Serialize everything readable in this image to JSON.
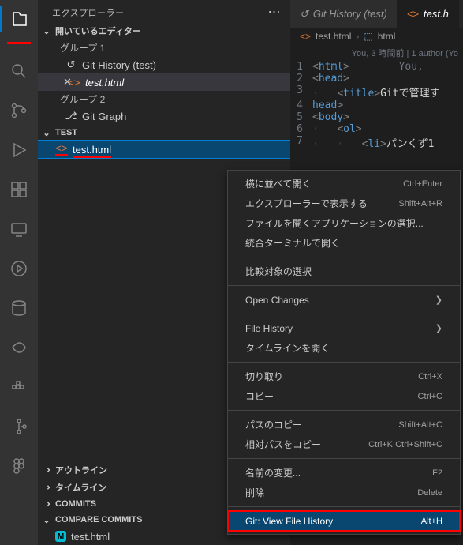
{
  "activity": {
    "items": [
      {
        "name": "files-icon",
        "active": true
      },
      {
        "name": "search-icon"
      },
      {
        "name": "source-control-icon"
      },
      {
        "name": "run-icon"
      },
      {
        "name": "extensions-icon"
      },
      {
        "name": "remote-icon"
      },
      {
        "name": "timeline-icon"
      },
      {
        "name": "database-icon"
      },
      {
        "name": "share-icon"
      },
      {
        "name": "docker-icon"
      },
      {
        "name": "git-icon"
      },
      {
        "name": "figma-icon"
      }
    ]
  },
  "sidebar": {
    "title": "エクスプローラー",
    "openEditors": {
      "label": "開いているエディター",
      "group1": "グループ 1",
      "group2": "グループ 2",
      "items1": [
        {
          "label": "Git History (test)",
          "icon": "history"
        },
        {
          "label": "test.html",
          "icon": "html",
          "active": true
        }
      ],
      "items2": [
        {
          "label": "Git Graph",
          "icon": "graph"
        }
      ]
    },
    "project": {
      "label": "TEST",
      "files": [
        {
          "label": "test.html",
          "icon": "html",
          "selected": true
        }
      ]
    },
    "outline": {
      "label": "アウトライン"
    },
    "timeline": {
      "label": "タイムライン"
    },
    "commits": {
      "label": "COMMITS"
    },
    "compare": {
      "label": "COMPARE COMMITS",
      "items": [
        {
          "badge": "M",
          "label": "test.html"
        }
      ]
    }
  },
  "editor": {
    "tabs": [
      {
        "label": "Git History (test)",
        "icon": "history"
      },
      {
        "label": "test.h",
        "icon": "html",
        "active": true
      }
    ],
    "breadcrumb": [
      {
        "icon": "html",
        "label": "test.html",
        "color": "orange"
      },
      {
        "icon": "brackets",
        "label": "html",
        "color": "blue"
      }
    ],
    "meta": "You, 3 時間前 | 1 author (Yo",
    "lines": [
      {
        "n": "1",
        "indent": 0,
        "open": "<",
        "tag": "html",
        "close": ">",
        "after": "        You,"
      },
      {
        "n": "2",
        "indent": 0,
        "open": "<",
        "tag": "head",
        "close": ">"
      },
      {
        "n": "3",
        "indent": 1,
        "open": "<",
        "tag": "title",
        "close": ">",
        "text": "Gitで管理す"
      },
      {
        "n": "4",
        "indent": 0,
        "open": "</",
        "tag": "head",
        "close": ">"
      },
      {
        "n": "5",
        "indent": 0,
        "open": "<",
        "tag": "body",
        "close": ">"
      },
      {
        "n": "6",
        "indent": 1,
        "open": "<",
        "tag": "ol",
        "close": ">"
      },
      {
        "n": "7",
        "indent": 2,
        "open": "<",
        "tag": "li",
        "close": ">",
        "text": "パンくず1</"
      }
    ]
  },
  "contextMenu": {
    "groups": [
      [
        {
          "label": "横に並べて開く",
          "kbd": "Ctrl+Enter"
        },
        {
          "label": "エクスプローラーで表示する",
          "kbd": "Shift+Alt+R"
        },
        {
          "label": "ファイルを開くアプリケーションの選択..."
        },
        {
          "label": "統合ターミナルで開く"
        }
      ],
      [
        {
          "label": "比較対象の選択"
        }
      ],
      [
        {
          "label": "Open Changes",
          "submenu": true
        }
      ],
      [
        {
          "label": "File History",
          "submenu": true
        },
        {
          "label": "タイムラインを開く"
        }
      ],
      [
        {
          "label": "切り取り",
          "kbd": "Ctrl+X"
        },
        {
          "label": "コピー",
          "kbd": "Ctrl+C"
        }
      ],
      [
        {
          "label": "パスのコピー",
          "kbd": "Shift+Alt+C"
        },
        {
          "label": "相対パスをコピー",
          "kbd": "Ctrl+K Ctrl+Shift+C"
        }
      ],
      [
        {
          "label": "名前の変更...",
          "kbd": "F2"
        },
        {
          "label": "削除",
          "kbd": "Delete"
        }
      ],
      [
        {
          "label": "Git: View File History",
          "kbd": "Alt+H",
          "highlight": true
        }
      ]
    ]
  }
}
